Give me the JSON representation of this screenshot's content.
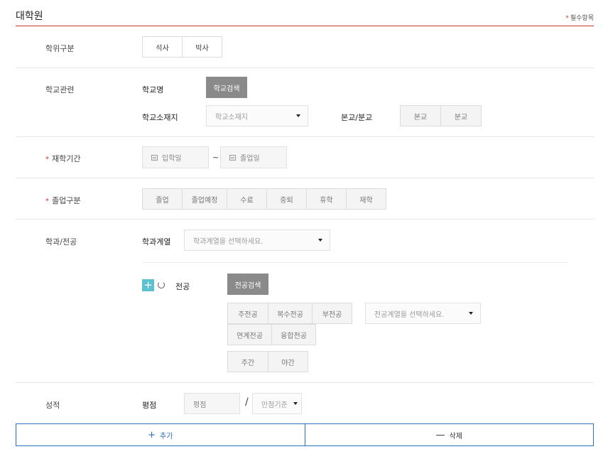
{
  "section": {
    "title": "대학원",
    "required_note": "필수항목",
    "star": "*"
  },
  "degree": {
    "label": "학위구분",
    "options": [
      "석사",
      "박사"
    ]
  },
  "school": {
    "label": "학교관련",
    "name_label": "학교명",
    "search_button": "학교검색",
    "location_label": "학교소재지",
    "location_placeholder": "학교소재지",
    "campus_label": "본교/분교",
    "campus_options": [
      "본교",
      "분교"
    ]
  },
  "period": {
    "label": "재학기간",
    "start_placeholder": "입학일",
    "separator": "~",
    "end_placeholder": "졸업일"
  },
  "graduation": {
    "label": "졸업구분",
    "options": [
      "졸업",
      "졸업예정",
      "수료",
      "중퇴",
      "휴학",
      "재학"
    ]
  },
  "major": {
    "label": "학과/전공",
    "field_label": "학과계열",
    "field_placeholder": "학과계열을 선택하세요.",
    "add_symbol": "+",
    "major_label": "전공",
    "search_button": "전공검색",
    "type_options_row1": [
      "주전공",
      "복수전공",
      "부전공"
    ],
    "type_options_row2": [
      "연계전공",
      "융합전공"
    ],
    "major_field_placeholder": "전공계열을 선택하세요.",
    "time_options": [
      "주간",
      "야간"
    ]
  },
  "grade": {
    "label": "성적",
    "gpa_label": "평점",
    "gpa_placeholder": "평점",
    "separator": "/",
    "max_placeholder": "만점기준"
  },
  "actions": {
    "add_symbol": "+",
    "add_label": "추가",
    "delete_symbol": "—",
    "delete_label": "삭제"
  },
  "colors": {
    "accent_red": "#c0392b",
    "accent_blue": "#2f6fc0",
    "accent_teal": "#5bc0cf"
  }
}
